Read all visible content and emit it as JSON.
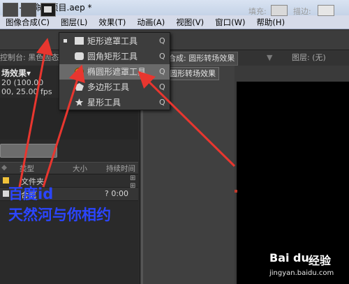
{
  "window": {
    "title": "cts - 未命名项目.aep *"
  },
  "menu": {
    "items": [
      "图像合成(C)",
      "图层(L)",
      "效果(T)",
      "动画(A)",
      "视图(V)",
      "窗口(W)",
      "帮助(H)"
    ]
  },
  "toolbar": {
    "fill_label": "填充:",
    "stroke_label": "描边:"
  },
  "panels": {
    "control_tab": "控制台: 黑色固态",
    "comp_tab": "合成: 圆形转场效果",
    "layer_tab": "图层: (无)",
    "sub_tab": "圆形转场效果"
  },
  "project": {
    "name": "场效果▾",
    "duration": "20 (100.00",
    "fps": "00, 25.00 fps",
    "columns": {
      "type": "类型",
      "size": "大小",
      "duration": "持续时间"
    },
    "rows": [
      {
        "name": "文件夹",
        "duration": ""
      },
      {
        "name": "合成",
        "duration": "? 0:00"
      }
    ]
  },
  "dropdown": {
    "items": [
      {
        "label": "矩形遮罩工具",
        "key": "Q",
        "icon": "rectangle-icon",
        "checked": true
      },
      {
        "label": "圆角矩形工具",
        "key": "Q",
        "icon": "rounded-rectangle-icon",
        "checked": false
      },
      {
        "label": "椭圆形遮罩工具",
        "key": "Q",
        "icon": "ellipse-icon",
        "checked": false,
        "highlighted": true
      },
      {
        "label": "多边形工具",
        "key": "Q",
        "icon": "polygon-icon",
        "checked": false
      },
      {
        "label": "星形工具",
        "key": "Q",
        "icon": "star-icon",
        "checked": false
      }
    ]
  },
  "annotation": {
    "line1": "百度id",
    "line2": "天然河与你相约"
  },
  "watermark": {
    "brand": "Bai du",
    "jingyan": "经验",
    "url": "jingyan.baidu.com"
  },
  "colors": {
    "annotation_arrow": "#e8362f",
    "annotation_text": "#2b45ff",
    "ellipse_icon": "#e0a020"
  }
}
